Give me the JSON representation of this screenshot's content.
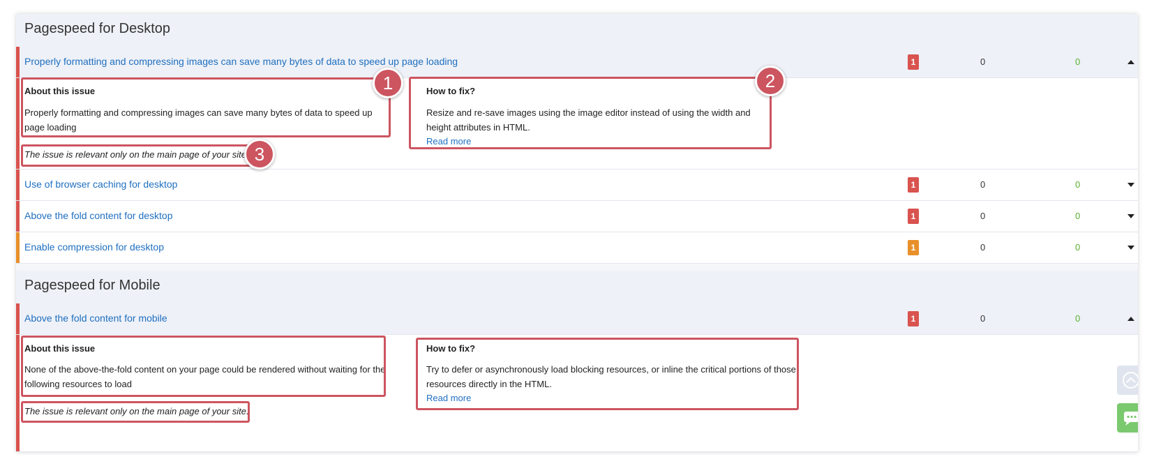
{
  "desktop": {
    "title": "Pagespeed for Desktop",
    "rows": [
      {
        "title": "Properly formatting and compressing images can save many bytes of data to speed up page loading",
        "badge": "1",
        "count_a": "0",
        "count_b": "0",
        "state": "expanded"
      },
      {
        "title": "Use of browser caching for desktop",
        "badge": "1",
        "count_a": "0",
        "count_b": "0",
        "state": "collapsed"
      },
      {
        "title": "Above the fold content for desktop",
        "badge": "1",
        "count_a": "0",
        "count_b": "0",
        "state": "collapsed"
      },
      {
        "title": "Enable compression for desktop",
        "badge": "1",
        "count_a": "0",
        "count_b": "0",
        "state": "collapsed"
      }
    ],
    "detail": {
      "about_heading": "About this issue",
      "about_text": "Properly formatting and compressing images can save many bytes of data to speed up page loading",
      "note": "The issue is relevant only on the main page of your site.",
      "fix_heading": "How to fix?",
      "fix_text": "Resize and re-save images using the image editor instead of using the width and height attributes in HTML.",
      "read_more": "Read more"
    }
  },
  "mobile": {
    "title": "Pagespeed for Mobile",
    "rows": [
      {
        "title": "Above the fold content for mobile",
        "badge": "1",
        "count_a": "0",
        "count_b": "0",
        "state": "expanded"
      }
    ],
    "detail": {
      "about_heading": "About this issue",
      "about_text": "None of the above-the-fold content on your page could be rendered without waiting for the following resources to load",
      "note": "The issue is relevant only on the main page of your site.",
      "fix_heading": "How to fix?",
      "fix_text": "Try to defer or asynchronously load blocking resources, or inline the critical portions of those resources directly in the HTML.",
      "read_more": "Read more"
    }
  },
  "annotations": [
    "1",
    "2",
    "3"
  ],
  "colors": {
    "error": "#d9534f",
    "warning": "#e8902a",
    "link": "#1f6fc0",
    "zero_green": "#5ab030",
    "highlight": "#cc5560"
  },
  "icons": {
    "expanded": "caret-up-icon",
    "collapsed": "caret-down-icon",
    "scroll_top": "chevron-up-circle-icon",
    "chat": "chat-icon"
  }
}
